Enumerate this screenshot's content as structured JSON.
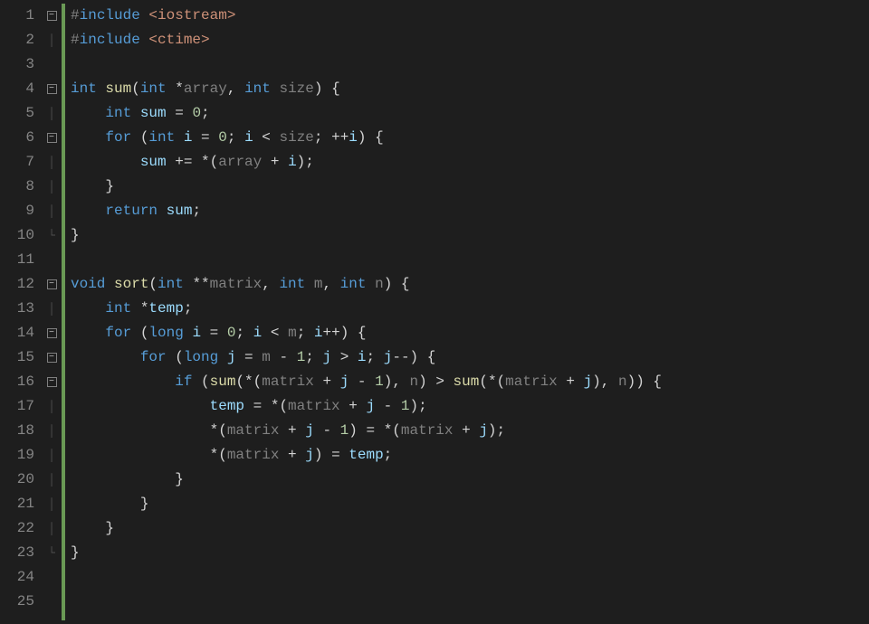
{
  "lines": [
    {
      "n": 1,
      "fold": "-",
      "tokens": [
        [
          "pp",
          "#"
        ],
        [
          "inc",
          "include "
        ],
        [
          "str",
          "<iostream>"
        ]
      ]
    },
    {
      "n": 2,
      "fold": "|",
      "tokens": [
        [
          "pp",
          "#"
        ],
        [
          "inc",
          "include "
        ],
        [
          "str",
          "<ctime>"
        ]
      ]
    },
    {
      "n": 3,
      "fold": "",
      "tokens": []
    },
    {
      "n": 4,
      "fold": "-",
      "tokens": [
        [
          "kw",
          "int "
        ],
        [
          "fn",
          "sum"
        ],
        [
          "pn",
          "("
        ],
        [
          "kw",
          "int "
        ],
        [
          "pn",
          "*"
        ],
        [
          "par",
          "array"
        ],
        [
          "pn",
          ", "
        ],
        [
          "kw",
          "int "
        ],
        [
          "par",
          "size"
        ],
        [
          "pn",
          ") {"
        ]
      ]
    },
    {
      "n": 5,
      "fold": "|",
      "tokens": [
        [
          "pn",
          "    "
        ],
        [
          "kw",
          "int "
        ],
        [
          "id",
          "sum"
        ],
        [
          "pn",
          " = "
        ],
        [
          "num",
          "0"
        ],
        [
          "pn",
          ";"
        ]
      ]
    },
    {
      "n": 6,
      "fold": "-",
      "tokens": [
        [
          "pn",
          "    "
        ],
        [
          "kw",
          "for "
        ],
        [
          "pn",
          "("
        ],
        [
          "kw",
          "int "
        ],
        [
          "id",
          "i"
        ],
        [
          "pn",
          " = "
        ],
        [
          "num",
          "0"
        ],
        [
          "pn",
          "; "
        ],
        [
          "id",
          "i"
        ],
        [
          "pn",
          " < "
        ],
        [
          "par",
          "size"
        ],
        [
          "pn",
          "; ++"
        ],
        [
          "id",
          "i"
        ],
        [
          "pn",
          ") {"
        ]
      ]
    },
    {
      "n": 7,
      "fold": "|",
      "tokens": [
        [
          "pn",
          "        "
        ],
        [
          "id",
          "sum"
        ],
        [
          "pn",
          " += *("
        ],
        [
          "par",
          "array"
        ],
        [
          "pn",
          " + "
        ],
        [
          "id",
          "i"
        ],
        [
          "pn",
          ");"
        ]
      ]
    },
    {
      "n": 8,
      "fold": "|",
      "tokens": [
        [
          "pn",
          "    }"
        ]
      ]
    },
    {
      "n": 9,
      "fold": "|",
      "tokens": [
        [
          "pn",
          "    "
        ],
        [
          "kw",
          "return "
        ],
        [
          "id",
          "sum"
        ],
        [
          "pn",
          ";"
        ]
      ]
    },
    {
      "n": 10,
      "fold": "L",
      "tokens": [
        [
          "pn",
          "}"
        ]
      ]
    },
    {
      "n": 11,
      "fold": "",
      "tokens": []
    },
    {
      "n": 12,
      "fold": "-",
      "tokens": [
        [
          "kw",
          "void "
        ],
        [
          "fn",
          "sort"
        ],
        [
          "pn",
          "("
        ],
        [
          "kw",
          "int "
        ],
        [
          "pn",
          "**"
        ],
        [
          "par",
          "matrix"
        ],
        [
          "pn",
          ", "
        ],
        [
          "kw",
          "int "
        ],
        [
          "par",
          "m"
        ],
        [
          "pn",
          ", "
        ],
        [
          "kw",
          "int "
        ],
        [
          "par",
          "n"
        ],
        [
          "pn",
          ") {"
        ]
      ]
    },
    {
      "n": 13,
      "fold": "|",
      "tokens": [
        [
          "pn",
          "    "
        ],
        [
          "kw",
          "int "
        ],
        [
          "pn",
          "*"
        ],
        [
          "id",
          "temp"
        ],
        [
          "pn",
          ";"
        ]
      ]
    },
    {
      "n": 14,
      "fold": "-",
      "tokens": [
        [
          "pn",
          "    "
        ],
        [
          "kw",
          "for "
        ],
        [
          "pn",
          "("
        ],
        [
          "kw",
          "long "
        ],
        [
          "id",
          "i"
        ],
        [
          "pn",
          " = "
        ],
        [
          "num",
          "0"
        ],
        [
          "pn",
          "; "
        ],
        [
          "id",
          "i"
        ],
        [
          "pn",
          " < "
        ],
        [
          "par",
          "m"
        ],
        [
          "pn",
          "; "
        ],
        [
          "id",
          "i"
        ],
        [
          "pn",
          "++) {"
        ]
      ]
    },
    {
      "n": 15,
      "fold": "-",
      "tokens": [
        [
          "pn",
          "        "
        ],
        [
          "kw",
          "for "
        ],
        [
          "pn",
          "("
        ],
        [
          "kw",
          "long "
        ],
        [
          "id",
          "j"
        ],
        [
          "pn",
          " = "
        ],
        [
          "par",
          "m"
        ],
        [
          "pn",
          " - "
        ],
        [
          "num",
          "1"
        ],
        [
          "pn",
          "; "
        ],
        [
          "id",
          "j"
        ],
        [
          "pn",
          " > "
        ],
        [
          "id",
          "i"
        ],
        [
          "pn",
          "; "
        ],
        [
          "id",
          "j"
        ],
        [
          "pn",
          "--) {"
        ]
      ]
    },
    {
      "n": 16,
      "fold": "-",
      "tokens": [
        [
          "pn",
          "            "
        ],
        [
          "kw",
          "if "
        ],
        [
          "pn",
          "("
        ],
        [
          "fn",
          "sum"
        ],
        [
          "pn",
          "(*("
        ],
        [
          "par",
          "matrix"
        ],
        [
          "pn",
          " + "
        ],
        [
          "id",
          "j"
        ],
        [
          "pn",
          " - "
        ],
        [
          "num",
          "1"
        ],
        [
          "pn",
          "), "
        ],
        [
          "par",
          "n"
        ],
        [
          "pn",
          ") > "
        ],
        [
          "fn",
          "sum"
        ],
        [
          "pn",
          "(*("
        ],
        [
          "par",
          "matrix"
        ],
        [
          "pn",
          " + "
        ],
        [
          "id",
          "j"
        ],
        [
          "pn",
          "), "
        ],
        [
          "par",
          "n"
        ],
        [
          "pn",
          ")) {"
        ]
      ]
    },
    {
      "n": 17,
      "fold": "|",
      "tokens": [
        [
          "pn",
          "                "
        ],
        [
          "id",
          "temp"
        ],
        [
          "pn",
          " = *("
        ],
        [
          "par",
          "matrix"
        ],
        [
          "pn",
          " + "
        ],
        [
          "id",
          "j"
        ],
        [
          "pn",
          " - "
        ],
        [
          "num",
          "1"
        ],
        [
          "pn",
          ");"
        ]
      ]
    },
    {
      "n": 18,
      "fold": "|",
      "tokens": [
        [
          "pn",
          "                *("
        ],
        [
          "par",
          "matrix"
        ],
        [
          "pn",
          " + "
        ],
        [
          "id",
          "j"
        ],
        [
          "pn",
          " - "
        ],
        [
          "num",
          "1"
        ],
        [
          "pn",
          ") = *("
        ],
        [
          "par",
          "matrix"
        ],
        [
          "pn",
          " + "
        ],
        [
          "id",
          "j"
        ],
        [
          "pn",
          ");"
        ]
      ]
    },
    {
      "n": 19,
      "fold": "|",
      "tokens": [
        [
          "pn",
          "                *("
        ],
        [
          "par",
          "matrix"
        ],
        [
          "pn",
          " + "
        ],
        [
          "id",
          "j"
        ],
        [
          "pn",
          ") = "
        ],
        [
          "id",
          "temp"
        ],
        [
          "pn",
          ";"
        ]
      ]
    },
    {
      "n": 20,
      "fold": "|",
      "tokens": [
        [
          "pn",
          "            }"
        ]
      ]
    },
    {
      "n": 21,
      "fold": "|",
      "tokens": [
        [
          "pn",
          "        }"
        ]
      ]
    },
    {
      "n": 22,
      "fold": "|",
      "tokens": [
        [
          "pn",
          "    }"
        ]
      ]
    },
    {
      "n": 23,
      "fold": "L",
      "tokens": [
        [
          "pn",
          "}"
        ]
      ]
    },
    {
      "n": 24,
      "fold": "",
      "tokens": []
    },
    {
      "n": 25,
      "fold": "",
      "tokens": []
    }
  ],
  "colors": {
    "background": "#1e1e1e",
    "modified_bar": "#6a9955",
    "keyword": "#569cd6",
    "function": "#dcdcaa",
    "string": "#ce9178",
    "identifier": "#9cdcfe",
    "param": "#808080",
    "number": "#b5cea8",
    "punct": "#d4d4d4",
    "line_number": "#858585"
  }
}
